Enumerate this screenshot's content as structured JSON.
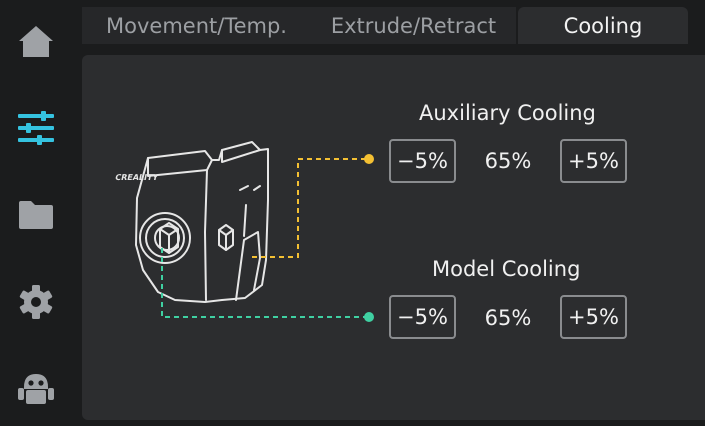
{
  "sidebar": {
    "items": [
      {
        "name": "home",
        "icon": "home-icon",
        "active": false
      },
      {
        "name": "tune",
        "icon": "sliders-icon",
        "active": true
      },
      {
        "name": "files",
        "icon": "folder-icon",
        "active": false
      },
      {
        "name": "settings",
        "icon": "gear-icon",
        "active": false
      },
      {
        "name": "robot",
        "icon": "robot-icon",
        "active": false
      }
    ]
  },
  "tabs": [
    {
      "label": "Movement/Temp.",
      "active": false
    },
    {
      "label": "Extrude/Retract",
      "active": false
    },
    {
      "label": "Cooling",
      "active": true
    }
  ],
  "device": {
    "brand": "CREALITY"
  },
  "auxiliary": {
    "title": "Auxiliary Cooling",
    "decrease_label": "−5%",
    "value": "65%",
    "increase_label": "+5%"
  },
  "model": {
    "title": "Model Cooling",
    "decrease_label": "−5%",
    "value": "65%",
    "increase_label": "+5%"
  },
  "colors": {
    "accent": "#35c3e0",
    "auxiliary_line": "#f4c033",
    "model_line": "#3fd0a2",
    "icon_inactive": "#9fa2a6"
  }
}
